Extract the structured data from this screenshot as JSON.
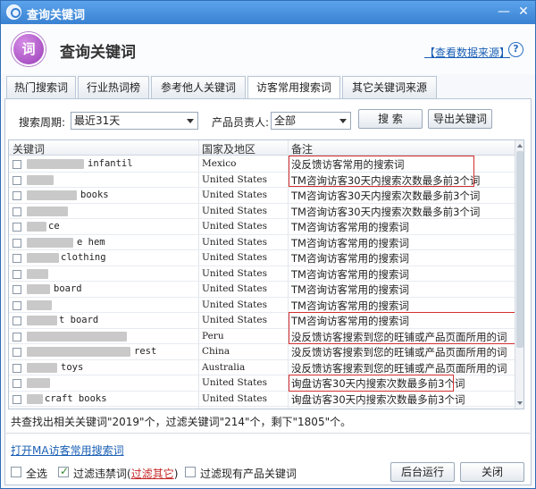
{
  "window": {
    "title": "查询关键词"
  },
  "header": {
    "title": "查询关键词",
    "logo_text": "词",
    "data_source_link": "【查看数据来源】",
    "help": "?"
  },
  "tabs": [
    {
      "label": "热门搜索词"
    },
    {
      "label": "行业热词榜"
    },
    {
      "label": "参考他人关键词"
    },
    {
      "label": "访客常用搜索词",
      "active": true
    },
    {
      "label": "其它关键词来源"
    }
  ],
  "filters": {
    "period_label": "搜索周期:",
    "period_value": "最近31天",
    "owner_label": "产品员责人:",
    "owner_value": "全部",
    "search_button": "搜 索",
    "export_button": "导出关键词"
  },
  "table": {
    "headers": {
      "keyword": "关键词",
      "region": "国家及地区",
      "note": "备注"
    },
    "rows": [
      {
        "keyword": "infantil",
        "region": "Mexico",
        "note": "没反馈访客常用的搜索词"
      },
      {
        "keyword": "",
        "region": "United States",
        "note": "TM咨询访客30天内搜索次数最多前3个词"
      },
      {
        "keyword": "books",
        "region": "United States",
        "note": "TM咨询访客30天内搜索次数最多前3个词"
      },
      {
        "keyword": "",
        "region": "United States",
        "note": "TM咨询访客30天内搜索次数最多前3个词"
      },
      {
        "keyword": "ce",
        "region": "United States",
        "note": "TM咨询访客常用的搜索词"
      },
      {
        "keyword": "e hem",
        "region": "United States",
        "note": "TM咨询访客常用的搜索词"
      },
      {
        "keyword": "clothing",
        "region": "United States",
        "note": "TM咨询访客常用的搜索词"
      },
      {
        "keyword": "",
        "region": "United States",
        "note": "TM咨询访客常用的搜索词"
      },
      {
        "keyword": "board",
        "region": "United States",
        "note": "TM咨询访客常用的搜索词"
      },
      {
        "keyword": "",
        "region": "United States",
        "note": "TM咨询访客常用的搜索词"
      },
      {
        "keyword": "t board",
        "region": "United States",
        "note": "TM咨询访客常用的搜索词"
      },
      {
        "keyword": "",
        "region": "Peru",
        "note": "没反馈访客搜索到您的旺铺或产品页面所用的词"
      },
      {
        "keyword": "rest",
        "region": "China",
        "note": "没反馈访客搜索到您的旺铺或产品页面所用的词"
      },
      {
        "keyword": "toys",
        "region": "Australia",
        "note": "没反馈访客搜索到您的旺铺或产品页面所用的词"
      },
      {
        "keyword": "",
        "region": "United States",
        "note": "询盘访客30天内搜索次数最多前3个词"
      },
      {
        "keyword": "craft books",
        "region": "United States",
        "note": "询盘访客30天内搜索次数最多前3个词"
      }
    ]
  },
  "summary": "共查找出相关关键词\"2019\"个，过滤关键词\"214\"个，剩下\"1805\"个。",
  "footer": {
    "ma_link": "打开MA访客常用搜索词",
    "select_all": "全选",
    "filter_banned": "过滤违禁词(",
    "filter_other": "过滤其它",
    "filter_banned_close": ")",
    "filter_existing": "过滤现有产品关键词",
    "run_background": "后台运行",
    "close": "关闭"
  }
}
